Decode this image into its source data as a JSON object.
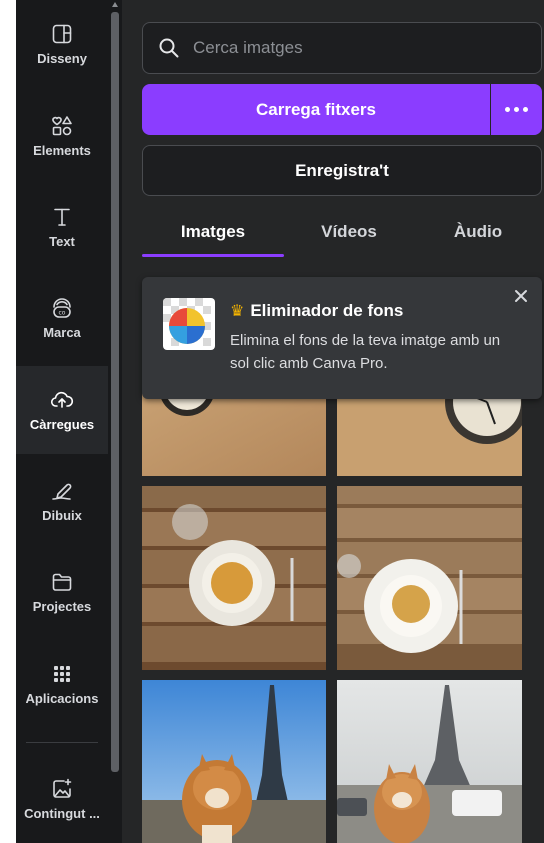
{
  "sidebar": {
    "items": [
      {
        "label": "Disseny",
        "icon": "layout-icon"
      },
      {
        "label": "Elements",
        "icon": "shapes-icon"
      },
      {
        "label": "Text",
        "icon": "text-icon"
      },
      {
        "label": "Marca",
        "icon": "brand-icon"
      },
      {
        "label": "Càrregues",
        "icon": "cloud-upload-icon",
        "active": true
      },
      {
        "label": "Dibuix",
        "icon": "pen-icon"
      },
      {
        "label": "Projectes",
        "icon": "folder-icon"
      },
      {
        "label": "Aplicacions",
        "icon": "apps-grid-icon"
      },
      {
        "label": "Contingut ...",
        "icon": "magic-image-icon"
      }
    ]
  },
  "search": {
    "placeholder": "Cerca imatges"
  },
  "upload": {
    "label": "Carrega fitxers",
    "more_icon": "more-icon"
  },
  "record": {
    "label": "Enregistra't"
  },
  "tabs": [
    {
      "label": "Imatges",
      "active": true
    },
    {
      "label": "Vídeos"
    },
    {
      "label": "Àudio"
    }
  ],
  "promo": {
    "title": "Eliminador de fons",
    "description": "Elimina el fons de la teva imatge amb un sol clic amb Canva Pro.",
    "icon": "crown-icon"
  },
  "gallery": {
    "items": [
      {
        "name": "clock-image-1"
      },
      {
        "name": "clock-image-2"
      },
      {
        "name": "pasta-image-1"
      },
      {
        "name": "pasta-image-2"
      },
      {
        "name": "dog-eiffel-image-1"
      },
      {
        "name": "dog-eiffel-image-2"
      }
    ]
  },
  "colors": {
    "accent": "#8b3dff",
    "panel_bg": "#252627",
    "rail_bg": "#18191b",
    "crown": "#f5b400"
  }
}
